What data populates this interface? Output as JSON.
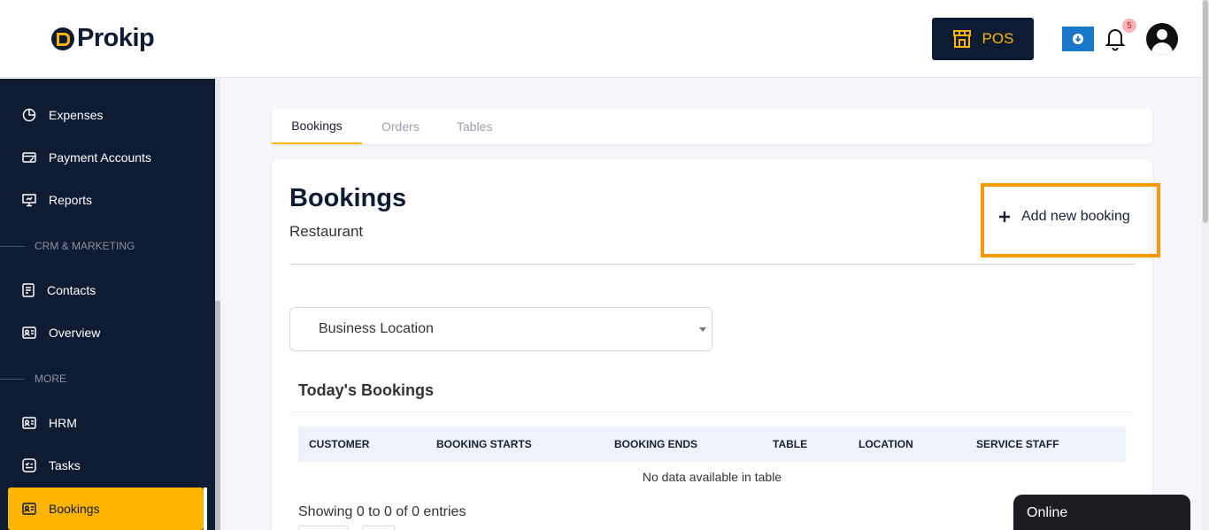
{
  "header": {
    "logo_text": "Prokip",
    "pos_label": "POS",
    "notification_count": "5"
  },
  "sidebar": {
    "items": [
      {
        "label": "Expenses",
        "icon": "pie-chart-icon"
      },
      {
        "label": "Payment Accounts",
        "icon": "card-icon"
      },
      {
        "label": "Reports",
        "icon": "presentation-icon"
      },
      {
        "label": "Contacts",
        "icon": "document-icon"
      },
      {
        "label": "Overview",
        "icon": "id-card-icon"
      },
      {
        "label": "HRM",
        "icon": "id-card-icon"
      },
      {
        "label": "Tasks",
        "icon": "tasks-icon"
      },
      {
        "label": "Bookings",
        "icon": "id-card-icon",
        "active": true
      }
    ],
    "sections": [
      "CRM & MARKETING",
      "MORE"
    ]
  },
  "tabs": [
    "Bookings",
    "Orders",
    "Tables"
  ],
  "main": {
    "title": "Bookings",
    "subtitle": "Restaurant",
    "add_button": "Add new booking",
    "location_select": "Business Location",
    "todays_heading": "Today's Bookings",
    "table": {
      "columns": [
        "CUSTOMER",
        "BOOKING STARTS",
        "BOOKING ENDS",
        "TABLE",
        "LOCATION",
        "SERVICE STAFF"
      ],
      "rows": [],
      "empty_text": "No data available in table"
    },
    "entries_text": "Showing 0 to 0 of 0 entries"
  },
  "chat": {
    "label": "Online"
  },
  "colors": {
    "accent": "#ffb400",
    "navy": "#0d1b33",
    "highlight": "#ff9800",
    "download": "#1976c9"
  }
}
